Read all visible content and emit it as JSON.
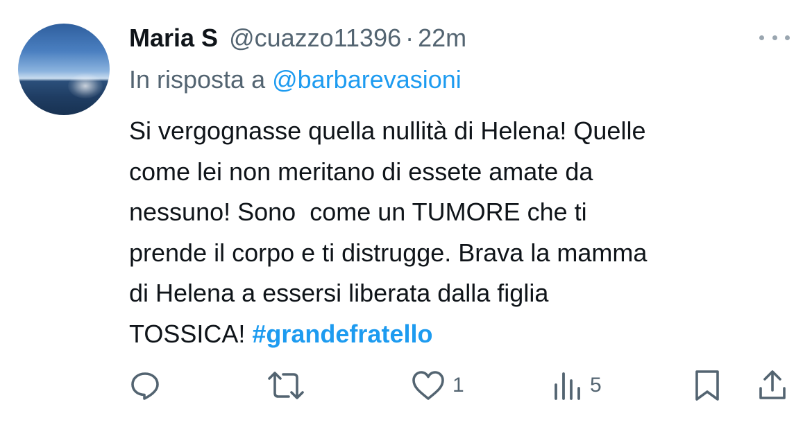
{
  "tweet": {
    "author_name": "Maria S",
    "handle": "@cuazzo11396",
    "separator": "·",
    "time": "22m",
    "reply_prefix": "In risposta a",
    "reply_to": "@barbarevasioni",
    "text_lines": [
      "Si vergognasse quella nullità di Helena! Quelle",
      "come lei non meritano di essete amate da",
      "nessuno! Sono  come un TUMORE che ti",
      "prende il corpo e ti distrugge. Brava la mamma",
      "di Helena a essersi liberata dalla figlia",
      "TOSSICA! "
    ],
    "hashtag": "#grandefratello"
  },
  "actions": {
    "reply_icon": "reply-icon",
    "retweet_icon": "retweet-icon",
    "like_icon": "heart-icon",
    "like_count": "1",
    "views_icon": "views-icon",
    "views_count": "5",
    "bookmark_icon": "bookmark-icon",
    "share_icon": "share-icon"
  },
  "colors": {
    "text": "#0f1419",
    "secondary": "#536471",
    "accent": "#1d9bf0",
    "background": "#ffffff"
  }
}
